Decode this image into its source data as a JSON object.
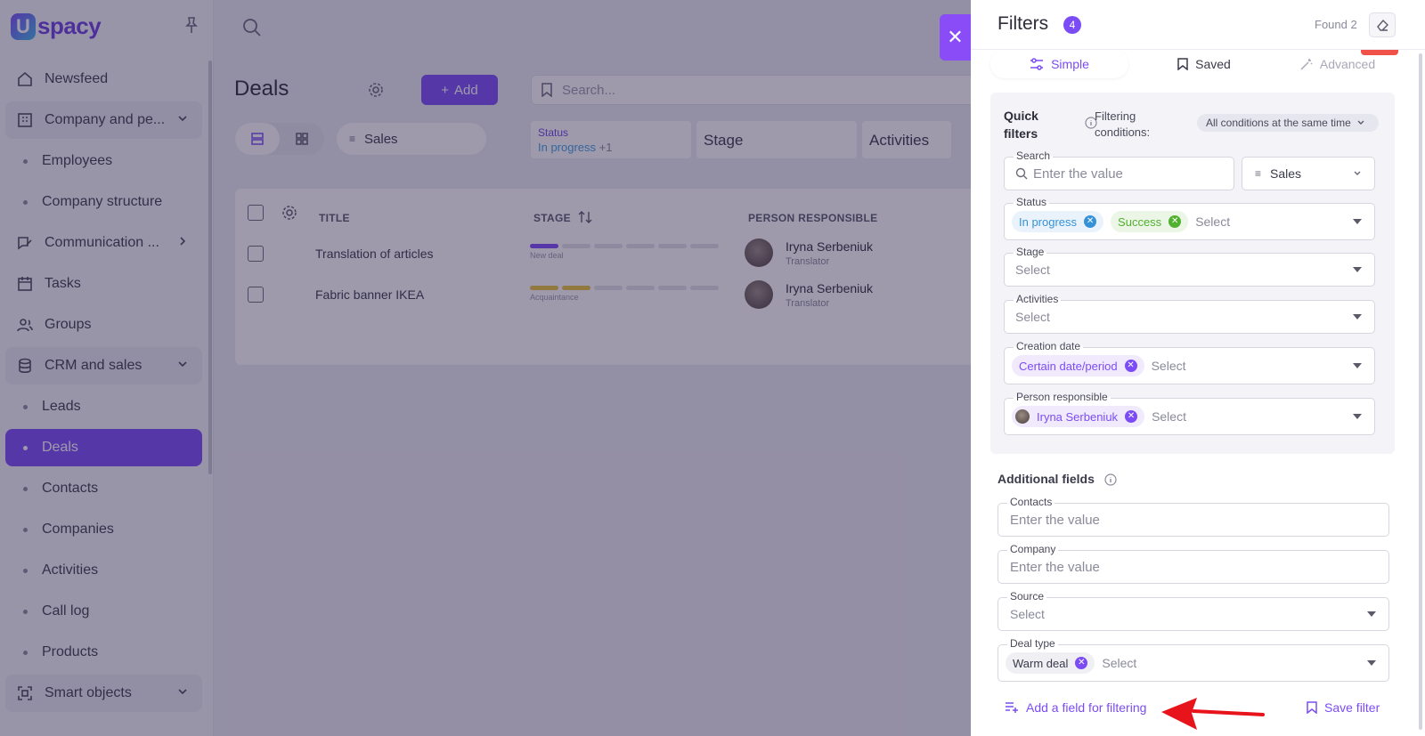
{
  "app": {
    "logo_letter": "U",
    "logo_text": "spacy"
  },
  "sidebar": {
    "items": [
      {
        "label": "Newsfeed",
        "icon": "home-icon"
      },
      {
        "label": "Company and pe...",
        "icon": "building-icon"
      },
      {
        "label": "Employees"
      },
      {
        "label": "Company structure"
      },
      {
        "label": "Communication ...",
        "icon": "chat-edit-icon"
      },
      {
        "label": "Tasks",
        "icon": "calendar-icon"
      },
      {
        "label": "Groups",
        "icon": "users-icon"
      },
      {
        "label": "CRM and sales",
        "icon": "database-icon"
      },
      {
        "label": "Leads"
      },
      {
        "label": "Deals"
      },
      {
        "label": "Contacts"
      },
      {
        "label": "Companies"
      },
      {
        "label": "Activities"
      },
      {
        "label": "Call log"
      },
      {
        "label": "Products"
      },
      {
        "label": "Smart objects",
        "icon": "scan-icon"
      }
    ]
  },
  "deals": {
    "title": "Deals",
    "add_label": "Add",
    "search_placeholder": "Search...",
    "pipeline": "Sales",
    "status_label": "Status",
    "status_value": "In progress",
    "status_more": "+1",
    "stage_label": "Stage",
    "activities_label": "Activities"
  },
  "table": {
    "headers": {
      "title": "TITLE",
      "stage": "STAGE",
      "person": "PERSON RESPONSIBLE"
    },
    "rows": [
      {
        "title": "Translation of articles",
        "stage": "New deal",
        "person": "Iryna Serbeniuk",
        "role": "Translator"
      },
      {
        "title": "Fabric banner IKEA",
        "stage": "Acquaintance",
        "person": "Iryna Serbeniuk",
        "role": "Translator"
      }
    ]
  },
  "filters": {
    "title": "Filters",
    "count": "4",
    "found": "Found 2",
    "tabs": {
      "simple": "Simple",
      "saved": "Saved",
      "advanced": "Advanced"
    },
    "quick": {
      "label": "Quick filters",
      "conditions_label": "Filtering conditions:",
      "conditions_value": "All conditions at the same time",
      "search_label": "Search",
      "search_placeholder": "Enter the value",
      "pipeline_value": "Sales",
      "status_label": "Status",
      "status_chips": [
        "In progress",
        "Success"
      ],
      "select_placeholder": "Select",
      "stage_label": "Stage",
      "activities_label": "Activities",
      "creation_label": "Creation date",
      "creation_chip": "Certain date/period",
      "person_label": "Person responsible",
      "person_chip": "Iryna Serbeniuk"
    },
    "additional": {
      "title": "Additional fields",
      "contacts_label": "Contacts",
      "company_label": "Company",
      "input_placeholder": "Enter the value",
      "source_label": "Source",
      "deal_type_label": "Deal type",
      "deal_type_chip": "Warm deal",
      "select_placeholder": "Select"
    },
    "footer": {
      "add_field": "Add a field for filtering",
      "save_filter": "Save filter"
    }
  },
  "colors": {
    "accent": "#7b4cf6",
    "status_blue": "#3592d6",
    "status_green": "#52b030",
    "arrow_red": "#e8141b"
  }
}
